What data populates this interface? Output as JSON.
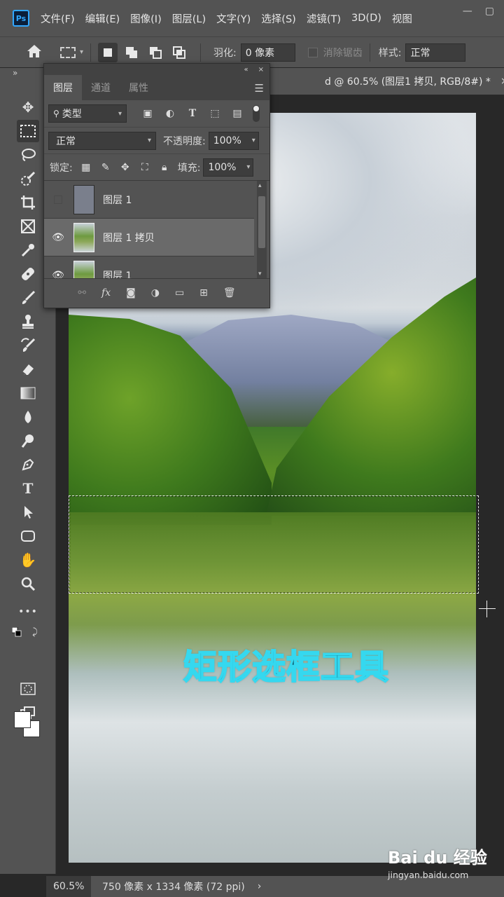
{
  "menubar": {
    "logo": "Ps",
    "items": [
      "文件(F)",
      "编辑(E)",
      "图像(I)",
      "图层(L)",
      "文字(Y)",
      "选择(S)",
      "滤镜(T)",
      "3D(D)",
      "视图"
    ],
    "window_min": "—",
    "window_max": "▢"
  },
  "options": {
    "feather_label": "羽化:",
    "feather_value": "0 像素",
    "antialias_label": "消除锯齿",
    "style_label": "样式:",
    "style_value": "正常"
  },
  "toolbar": {
    "collapse": "»",
    "tools": [
      "move-tool",
      "rectangular-marquee-tool",
      "lasso-tool",
      "quick-selection-tool",
      "crop-tool",
      "frame-tool",
      "eyedropper-tool",
      "healing-brush-tool",
      "brush-tool",
      "clone-stamp-tool",
      "history-brush-tool",
      "eraser-tool",
      "gradient-tool",
      "blur-tool",
      "dodge-tool",
      "pen-tool",
      "type-tool",
      "path-selection-tool",
      "rectangle-tool",
      "hand-tool",
      "zoom-tool",
      "edit-toolbar",
      "default-colors",
      "swap-colors"
    ],
    "more": "•••"
  },
  "document_tab": {
    "title": "d @ 60.5% (图层1 拷贝, RGB/8#) *",
    "close": "×"
  },
  "layers_panel": {
    "collapse": "«",
    "close": "×",
    "tabs": [
      "图层",
      "通道",
      "属性"
    ],
    "active_tab": "图层",
    "filter_label": "类型",
    "blend_mode": "正常",
    "opacity_label": "不透明度:",
    "opacity_value": "100%",
    "lock_label": "锁定:",
    "fill_label": "填充:",
    "fill_value": "100%",
    "layers": [
      {
        "name": "图层 1",
        "visible": false,
        "selected": false
      },
      {
        "name": "图层 1 拷贝",
        "visible": true,
        "selected": true
      },
      {
        "name": "图层 1",
        "visible": true,
        "selected": false
      }
    ]
  },
  "canvas": {
    "caption": "矩形选框工具"
  },
  "status": {
    "zoom": "60.5%",
    "doc_info": "750 像素 x 1334 像素 (72 ppi)",
    "arrow": "›"
  },
  "watermark": {
    "logo": "Bai du 经验",
    "url": "jingyan.baidu.com"
  }
}
